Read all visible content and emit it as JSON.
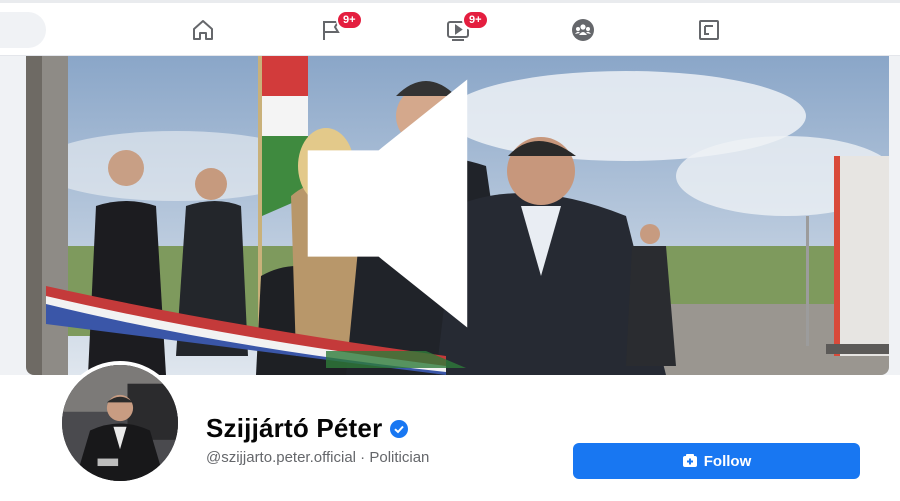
{
  "nav": {
    "items": [
      {
        "icon": "home-icon"
      },
      {
        "icon": "flag-icon",
        "badge": "9+"
      },
      {
        "icon": "video-icon",
        "badge": "9+"
      },
      {
        "icon": "groups-icon"
      },
      {
        "icon": "gaming-icon"
      }
    ]
  },
  "profile": {
    "name": "Szijjártó Péter",
    "handle": "@szijjarto.peter.official",
    "separator": " · ",
    "category": "Politician",
    "follow_label": "Follow"
  },
  "colors": {
    "accent": "#1877f2",
    "badge": "#e41e3f"
  }
}
